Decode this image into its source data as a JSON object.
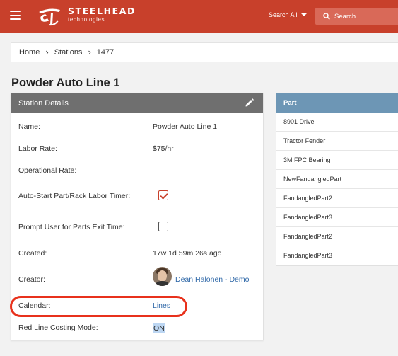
{
  "header": {
    "brand_name": "STEELHEAD",
    "brand_sub": "technologies",
    "search_scope": "Search All",
    "search_placeholder": "Search...",
    "accent_color": "#c8402b"
  },
  "breadcrumb": [
    "Home",
    "Stations",
    "1477"
  ],
  "page_title": "Powder Auto Line 1",
  "station_details": {
    "title": "Station Details",
    "fields": {
      "name": {
        "label": "Name:",
        "value": "Powder Auto Line 1"
      },
      "labor_rate": {
        "label": "Labor Rate:",
        "value": "$75/hr"
      },
      "operational_rate": {
        "label": "Operational Rate:",
        "value": ""
      },
      "auto_start": {
        "label": "Auto-Start Part/Rack Labor Timer:",
        "checked": true
      },
      "prompt_exit": {
        "label": "Prompt User for Parts Exit Time:",
        "checked": false
      },
      "created": {
        "label": "Created:",
        "value": "17w 1d 59m 26s ago"
      },
      "creator": {
        "label": "Creator:",
        "value": "Dean Halonen - Demo"
      },
      "calendar": {
        "label": "Calendar:",
        "value": "Lines"
      },
      "red_line": {
        "label": "Red Line Costing Mode:",
        "value": "ON"
      }
    }
  },
  "parts": {
    "header": "Part",
    "rows": [
      "8901 Drive",
      "Tractor Fender",
      "3M FPC Bearing",
      "NewFandangledPart",
      "FandangledPart2",
      "FandangledPart3",
      "FandangledPart2",
      "FandangledPart3"
    ]
  }
}
